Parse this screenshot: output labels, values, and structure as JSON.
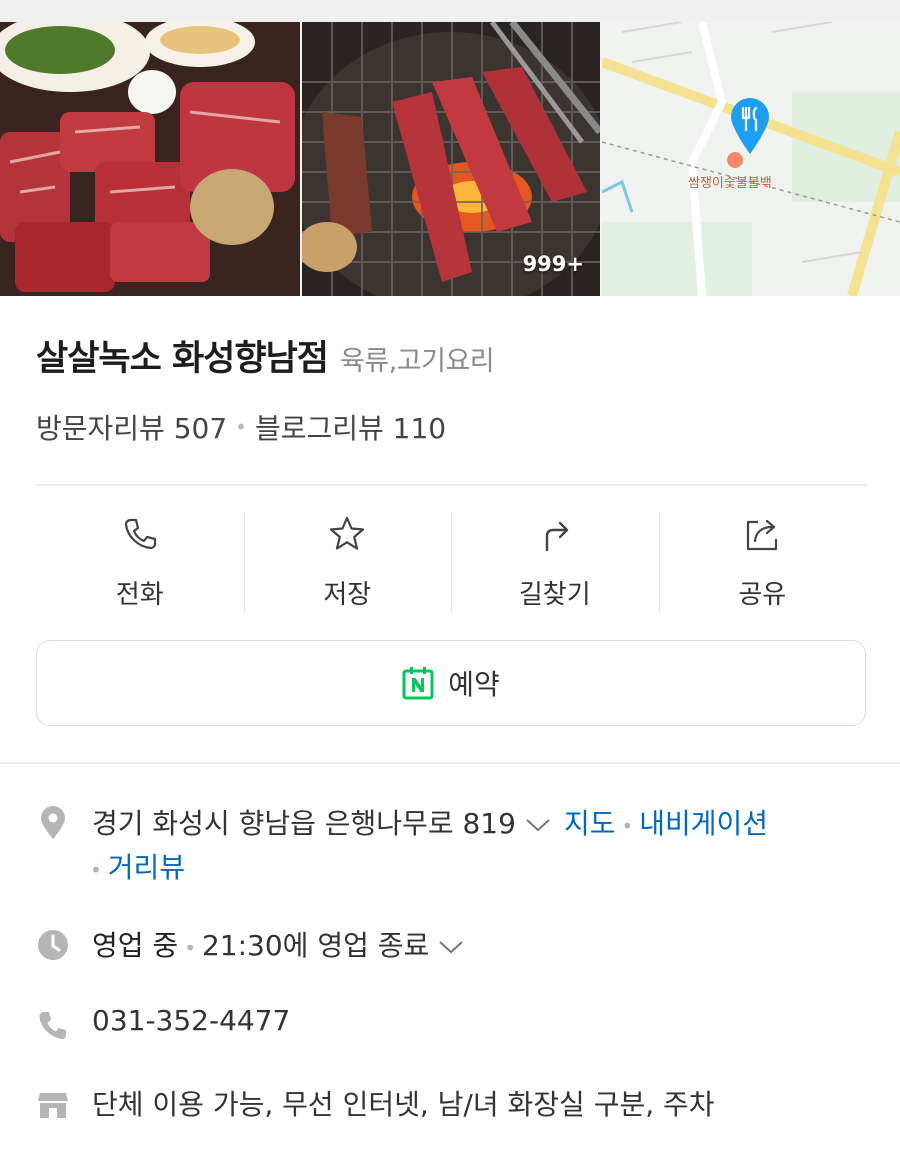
{
  "photos": {
    "count_badge": "999+",
    "map_place_label": "쌈쟁이숯불불백"
  },
  "place": {
    "name": "살살녹소 화성향남점",
    "category": "육류,고기요리",
    "visitor_reviews": "방문자리뷰 507",
    "blog_reviews": "블로그리뷰 110"
  },
  "actions": {
    "call": "전화",
    "save": "저장",
    "directions": "길찾기",
    "share": "공유",
    "reserve": "예약"
  },
  "info": {
    "address": "경기 화성시 향남읍 은행나무로 819",
    "map_link": "지도",
    "navigation_link": "내비게이션",
    "street_view_link": "거리뷰",
    "status": "영업 중",
    "hours": "21:30에 영업 종료",
    "phone": "031-352-4477",
    "amenities": "단체 이용 가능, 무선 인터넷, 남/녀 화장실 구분, 주차"
  },
  "colors": {
    "link": "#0068c3",
    "naver_green": "#03c75a",
    "map_pin": "#1e9ef0"
  },
  "icons": {
    "call": "phone-icon",
    "save": "star-icon",
    "directions": "turn-arrow-icon",
    "share": "share-icon",
    "reserve": "naver-booking-icon",
    "address": "location-pin-icon",
    "hours": "clock-icon",
    "phone": "phone-icon",
    "amenities": "store-icon"
  }
}
